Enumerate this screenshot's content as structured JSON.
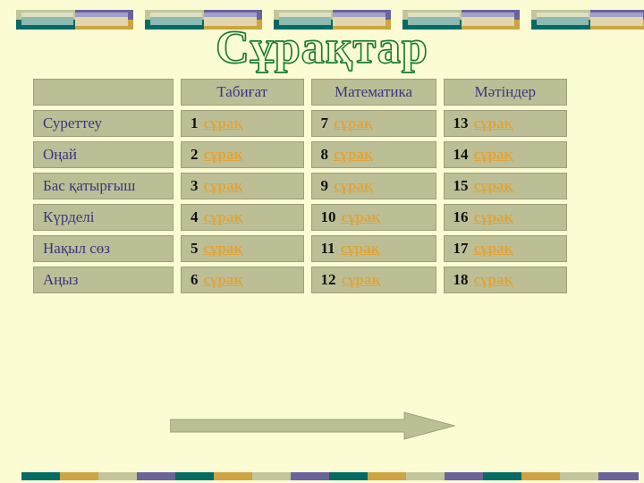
{
  "page": {
    "title": "Сұрақтар",
    "background_color": "#fcfcd4",
    "cell_color": "#bcbf96",
    "heading_text_color": "#3b3580",
    "link_color": "#e0a43c",
    "title_outline_color": "#2e8b40"
  },
  "decor": {
    "top_block_count": 5,
    "top_colors": {
      "sage": "#c3c69b",
      "purple": "#6a639e",
      "teal": "#046a64",
      "gold": "#cfa341"
    },
    "bottom_sequence": [
      "#046a64",
      "#cfa341",
      "#c3c69b",
      "#6a639e"
    ],
    "bottom_block_count": 16
  },
  "table": {
    "headers": [
      "",
      "Табиғат",
      "Математика",
      "Мәтіндер"
    ],
    "row_labels": [
      "Суреттеу",
      "Оңай",
      "Бас қатырғыш",
      "Күрделі",
      "Нақыл сөз",
      "Аңыз"
    ],
    "link_label": "сұрақ",
    "rows": [
      {
        "label": "Суреттеу",
        "cells": [
          {
            "number": "1",
            "label": "сұрақ",
            "state": "normal"
          },
          {
            "number": "7",
            "label": "сұрақ",
            "state": "lavender"
          },
          {
            "number": "13",
            "label": "сұрақ",
            "state": "normal"
          }
        ]
      },
      {
        "label": "Оңай",
        "cells": [
          {
            "number": "2",
            "label": "сұрақ",
            "state": "normal"
          },
          {
            "number": "8",
            "label": "сұрақ",
            "state": "navy"
          },
          {
            "number": "14",
            "label": "сұрақ",
            "state": "normal"
          }
        ]
      },
      {
        "label": "Бас қатырғыш",
        "cells": [
          {
            "number": "3",
            "label": "сұрақ",
            "state": "normal"
          },
          {
            "number": "9",
            "label": "сұрақ",
            "state": "thin-navy"
          },
          {
            "number": "15",
            "label": "сұрақ",
            "state": "normal"
          }
        ]
      },
      {
        "label": "Күрделі",
        "cells": [
          {
            "number": "4",
            "label": "сұрақ",
            "state": "normal"
          },
          {
            "number": "10",
            "label": "сұрақ",
            "state": "normal"
          },
          {
            "number": "16",
            "label": "сұрақ",
            "state": "normal"
          }
        ]
      },
      {
        "label": "Нақыл сөз",
        "cells": [
          {
            "number": "5",
            "label": "сұрақ",
            "state": "normal"
          },
          {
            "number": "11",
            "label": "сұрақ",
            "state": "normal"
          },
          {
            "number": "17",
            "label": "сұрақ",
            "state": "normal"
          }
        ]
      },
      {
        "label": "Аңыз",
        "cells": [
          {
            "number": "6",
            "label": "сұрақ",
            "state": "normal"
          },
          {
            "number": "12",
            "label": "сұрақ",
            "state": "normal"
          },
          {
            "number": "18",
            "label": "сұрақ",
            "state": "normal"
          }
        ]
      }
    ]
  },
  "arrow": {
    "direction": "right",
    "fill_color": "#bcbf96"
  }
}
